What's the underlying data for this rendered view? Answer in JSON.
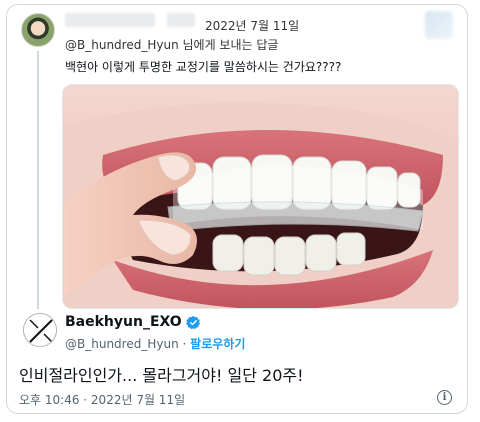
{
  "reply_tweet": {
    "date": "2022년 7월 11일",
    "replying_to": "@B_hundred_Hyun 님에게 보내는 답글",
    "text": "백현아 이렇게 투명한 교정기를 말씀하시는 건가요????"
  },
  "quoted_tweet": {
    "display_name": "Baekhyun_EXO",
    "handle": "@B_hundred_Hyun",
    "separator": "·",
    "follow_label": "팔로우하기",
    "text": "인비절라인인가... 몰라그거야! 일단 20주!",
    "timestamp": "오후 10:46 · 2022년 7월 11일"
  },
  "icons": {
    "verified": "verified-badge-icon",
    "info": "info-icon"
  },
  "colors": {
    "accent": "#1d9bf0",
    "border": "#cfd9de",
    "secondary_text": "#536471"
  }
}
